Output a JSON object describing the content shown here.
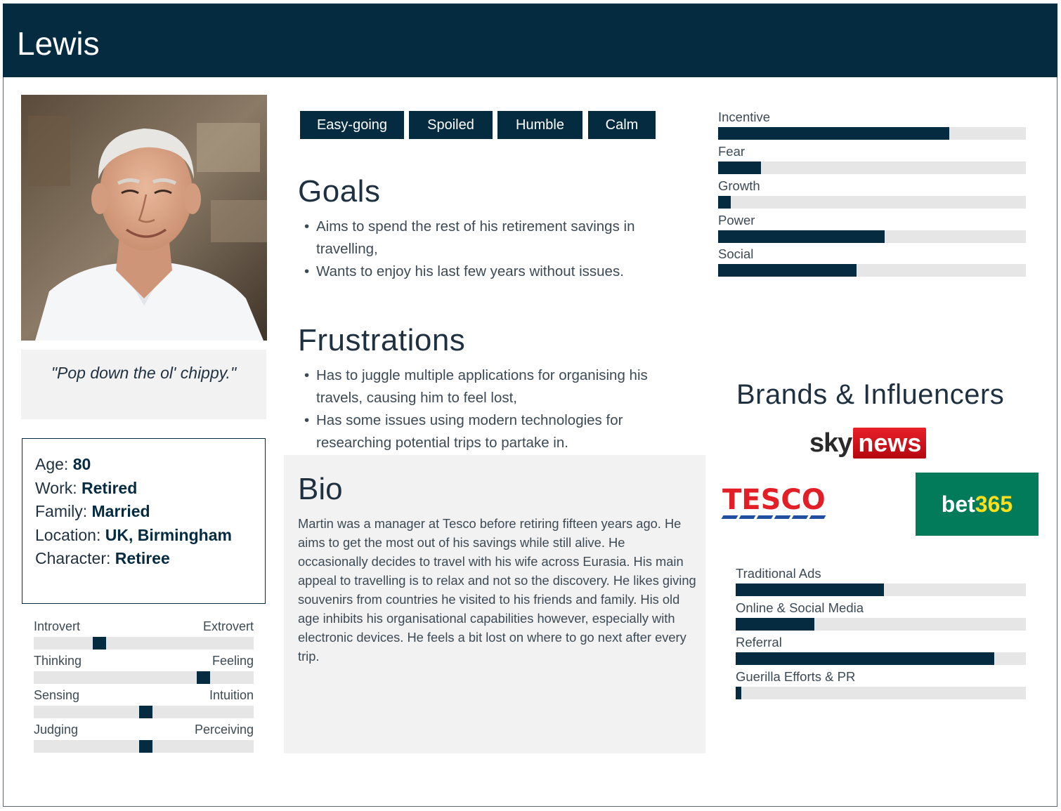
{
  "persona": {
    "name": "Lewis",
    "quote": "\"Pop down the ol' chippy.\""
  },
  "info": [
    {
      "label": "Age:",
      "value": "80"
    },
    {
      "label": "Work:",
      "value": "Retired"
    },
    {
      "label": "Family:",
      "value": "Married"
    },
    {
      "label": "Location:",
      "value": "UK, Birmingham"
    },
    {
      "label": "Character:",
      "value": "Retiree"
    }
  ],
  "personality": [
    {
      "left": "Introvert",
      "right": "Extrovert",
      "value": 0.3
    },
    {
      "left": "Thinking",
      "right": "Feeling",
      "value": 0.77
    },
    {
      "left": "Sensing",
      "right": "Intuition",
      "value": 0.51
    },
    {
      "left": "Judging",
      "right": "Perceiving",
      "value": 0.51
    }
  ],
  "traits": [
    "Easy-going",
    "Spoiled",
    "Humble",
    "Calm"
  ],
  "goals": {
    "title": "Goals",
    "items": [
      "Aims to spend the rest of his retirement savings in travelling,",
      "Wants to enjoy his last few years without issues."
    ]
  },
  "frustrations": {
    "title": "Frustrations",
    "items": [
      "Has to juggle multiple applications for organising his travels, causing him to feel lost,",
      "Has some issues using modern technologies for researching potential trips to partake in."
    ]
  },
  "bio": {
    "title": "Bio",
    "text": "Martin was a manager at Tesco before retiring fifteen years ago. He aims to get the most out of his savings while still alive. He occasionally decides to travel with his wife across Eurasia. His main appeal to travelling is to relax and not so the discovery. He likes giving souvenirs from countries he visited to his friends and family. His old age inhibits his organisational capabilities however, especially with electronic devices. He feels a bit lost on where to go next after every trip."
  },
  "motivations": [
    {
      "label": "Incentive",
      "value": 0.75
    },
    {
      "label": "Fear",
      "value": 0.14
    },
    {
      "label": "Growth",
      "value": 0.04
    },
    {
      "label": "Power",
      "value": 0.54
    },
    {
      "label": "Social",
      "value": 0.45
    }
  ],
  "brands": {
    "title": "Brands & Influencers",
    "sky": "sky",
    "news": "news",
    "tesco": "TESCO",
    "bet_part1": "bet",
    "bet_part2": "365"
  },
  "channels": [
    {
      "label": "Traditional Ads",
      "value": 0.51
    },
    {
      "label": "Online & Social Media",
      "value": 0.27
    },
    {
      "label": "Referral",
      "value": 0.89
    },
    {
      "label": "Guerilla Efforts & PR",
      "value": 0.02
    }
  ],
  "colors": {
    "navy": "#052b40",
    "track": "#e6e6e6",
    "panel": "#f2f2f2"
  }
}
